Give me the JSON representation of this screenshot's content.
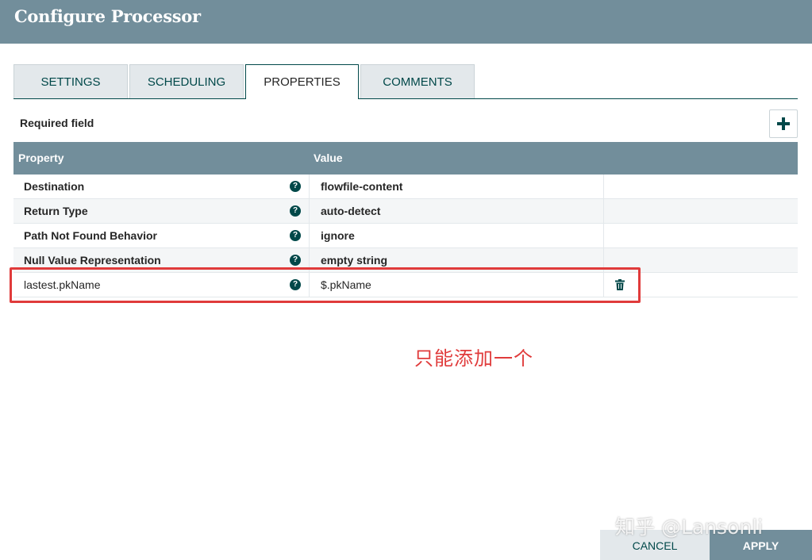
{
  "dialog": {
    "title": "Configure Processor"
  },
  "tabs": [
    {
      "label": "SETTINGS"
    },
    {
      "label": "SCHEDULING"
    },
    {
      "label": "PROPERTIES",
      "active": true
    },
    {
      "label": "COMMENTS"
    }
  ],
  "properties_panel": {
    "required_label": "Required field",
    "add_icon": "plus-icon",
    "columns": {
      "property": "Property",
      "value": "Value"
    },
    "rows": [
      {
        "name": "Destination",
        "value": "flowfile-content",
        "required": true
      },
      {
        "name": "Return Type",
        "value": "auto-detect",
        "required": true
      },
      {
        "name": "Path Not Found Behavior",
        "value": "ignore",
        "required": true
      },
      {
        "name": "Null Value Representation",
        "value": "empty string",
        "required": true
      },
      {
        "name": "lastest.pkName",
        "value": "$.pkName",
        "required": false,
        "deletable": true
      }
    ],
    "help_glyph": "?"
  },
  "annotation": {
    "text": "只能添加一个",
    "color": "#e03b3b"
  },
  "footer": {
    "cancel_label": "CANCEL",
    "apply_label": "APPLY"
  },
  "watermark": {
    "text": "知乎 @Lansonli"
  },
  "colors": {
    "header": "#728e9b",
    "accent": "#004849",
    "highlight": "#e03b3b"
  }
}
